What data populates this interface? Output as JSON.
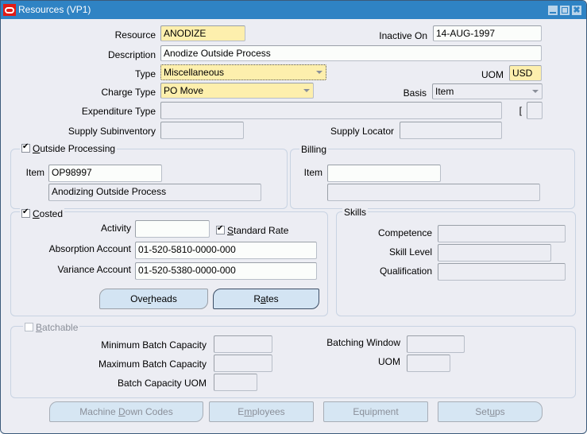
{
  "window": {
    "title": "Resources (VP1)",
    "controls": {
      "minimize": "",
      "maximize": "",
      "close": "✖"
    }
  },
  "header": {
    "resource_label": "Resource",
    "resource_value": "ANODIZE",
    "inactive_on_label": "Inactive On",
    "inactive_on_value": "14-AUG-1997",
    "description_label": "Description",
    "description_value": "Anodize Outside Process",
    "type_label": "Type",
    "type_value": "Miscellaneous",
    "uom_label": "UOM",
    "uom_value": "USD",
    "charge_type_label": "Charge Type",
    "charge_type_value": "PO Move",
    "basis_label": "Basis",
    "basis_value": "Item",
    "expenditure_type_label": "Expenditure Type",
    "expenditure_type_value": "",
    "bracket_label": "[",
    "supply_subinventory_label": "Supply Subinventory",
    "supply_subinventory_value": "",
    "supply_locator_label": "Supply Locator",
    "supply_locator_value": ""
  },
  "outside_processing": {
    "title_prefix": "",
    "title_mnemonic": "O",
    "title_rest": "utside Processing",
    "checked": true,
    "item_label": "Item",
    "item_value": "OP98997",
    "item_description": "Anodizing Outside Process"
  },
  "billing": {
    "title": "Billing",
    "item_label": "Item",
    "item_value": "",
    "item_description": ""
  },
  "costed": {
    "title_mnemonic": "C",
    "title_rest": "osted",
    "checked": true,
    "activity_label": "Activity",
    "activity_value": "",
    "standard_rate_mnemonic": "S",
    "standard_rate_rest": "tandard Rate",
    "standard_rate_checked": true,
    "absorption_label": "Absorption Account",
    "absorption_value": "01-520-5810-0000-000",
    "variance_label": "Variance Account",
    "variance_value": "01-520-5380-0000-000",
    "overheads_pre": "Ove",
    "overheads_mnemonic": "r",
    "overheads_post": "heads",
    "rates_pre": "R",
    "rates_mnemonic": "a",
    "rates_post": "tes"
  },
  "skills": {
    "title": "Skills",
    "competence_label": "Competence",
    "skill_level_label": "Skill Level",
    "qualification_label": "Qualification"
  },
  "batch": {
    "title_mnemonic": "B",
    "title_rest": "atchable",
    "checked": false,
    "min_label": "Minimum Batch Capacity",
    "max_label": "Maximum Batch Capacity",
    "uom_cap_label": "Batch Capacity UOM",
    "window_label": "Batching Window",
    "uom_label": "UOM"
  },
  "footer_buttons": {
    "machine_pre": "Machine ",
    "machine_mnemonic": "D",
    "machine_post": "own Codes",
    "employees_pre": "E",
    "employees_mnemonic": "m",
    "employees_post": "ployees",
    "equipment": "Equipment",
    "setups_pre": "Set",
    "setups_mnemonic": "u",
    "setups_post": "ps"
  }
}
